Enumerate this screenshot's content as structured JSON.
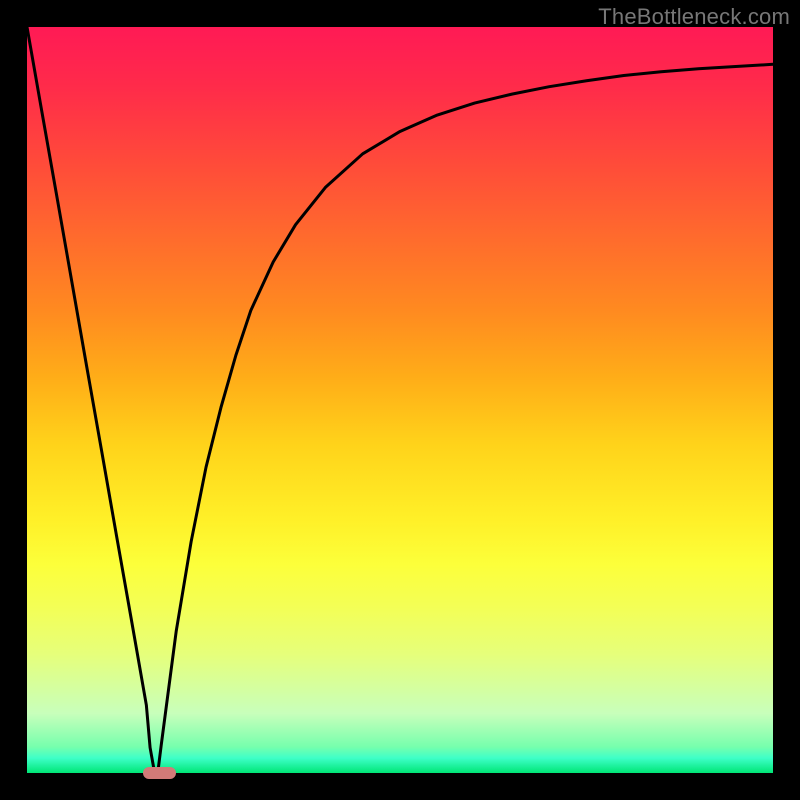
{
  "watermark": "TheBottleneck.com",
  "chart_data": {
    "type": "line",
    "title": "",
    "xlabel": "",
    "ylabel": "",
    "xlim": [
      0,
      100
    ],
    "ylim": [
      0,
      100
    ],
    "grid": false,
    "series": [
      {
        "name": "bottleneck-curve",
        "x": [
          0,
          2,
          4,
          6,
          8,
          10,
          12,
          14,
          16,
          16.5,
          17,
          17.6,
          18,
          20,
          22,
          24,
          26,
          28,
          30,
          33,
          36,
          40,
          45,
          50,
          55,
          60,
          65,
          70,
          75,
          80,
          85,
          90,
          95,
          100
        ],
        "y": [
          100,
          88.6,
          77.3,
          65.9,
          54.5,
          43.2,
          31.8,
          20.5,
          9.1,
          3.4,
          0.6,
          0.6,
          3.8,
          19,
          31,
          41,
          49,
          56,
          62,
          68.5,
          73.5,
          78.5,
          83,
          86,
          88.2,
          89.8,
          91,
          92,
          92.8,
          93.5,
          94,
          94.4,
          94.7,
          95
        ]
      }
    ],
    "optimal_band": {
      "x_start": 15.5,
      "x_end": 20,
      "y": 0
    },
    "background_gradient": {
      "top": "#ff1a55",
      "mid": "#ffe030",
      "bottom": "#00e676"
    }
  },
  "colors": {
    "curve": "#000000",
    "marker": "#d17a78",
    "frame": "#000000"
  }
}
